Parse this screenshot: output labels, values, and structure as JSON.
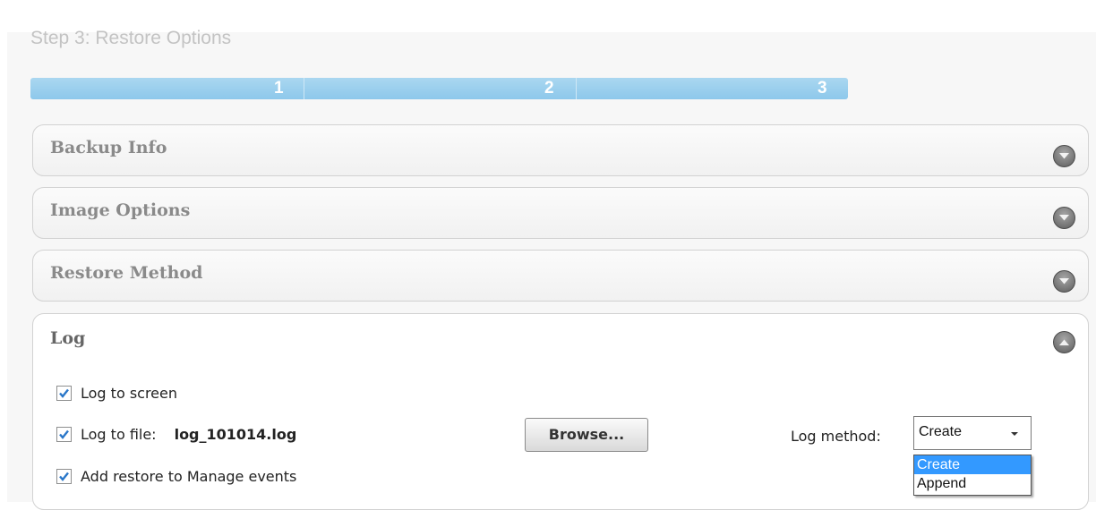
{
  "wizard": {
    "step_title": "Step 3: Restore Options",
    "steps": [
      "1",
      "2",
      "3"
    ]
  },
  "panels": {
    "backup_info": "Backup Info",
    "image_options": "Image Options",
    "restore_method": "Restore Method",
    "log": "Log"
  },
  "log": {
    "log_to_screen": {
      "label": "Log to screen",
      "checked": true
    },
    "log_to_file": {
      "label": "Log to file:",
      "checked": true,
      "filename": "log_101014.log"
    },
    "add_restore": {
      "label": "Add restore to Manage events",
      "checked": true
    },
    "browse_label": "Browse...",
    "method_label": "Log method:",
    "method_value": "Create",
    "method_options": [
      "Create",
      "Append"
    ]
  },
  "colors": {
    "progress": "#8dc8eb",
    "highlight": "#3399ff",
    "check": "#2a77c9"
  }
}
